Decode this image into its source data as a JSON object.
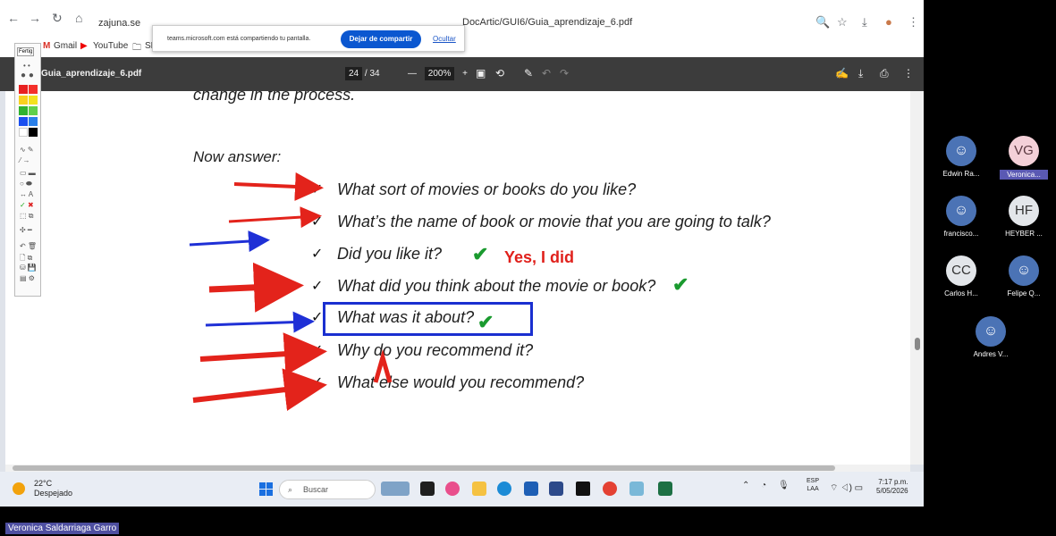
{
  "browser": {
    "url_host": "zajuna.se",
    "url_path": "DocArtic/GUI6/Guia_aprendizaje_6.pdf",
    "bookmarks": [
      "Gmail",
      "YouTube",
      "SE"
    ]
  },
  "share_banner": {
    "text": "teams.microsoft.com está compartiendo tu pantalla.",
    "stop_label": "Dejar de compartir",
    "hide_label": "Ocultar"
  },
  "pdf": {
    "file_name": "Guia_aprendizaje_6.pdf",
    "page_current": "24",
    "page_total": "/ 34",
    "zoom": "200%",
    "zoom_minus": "—",
    "zoom_plus": "+"
  },
  "document": {
    "top_line": "change in the process.",
    "heading": "Now answer:",
    "questions": [
      "What sort of movies or books do you like?",
      "What’s the name of book or movie that you are going to talk?",
      "Did you like it?",
      "What did you think about the movie or book?",
      "What was it about?",
      "Why do you recommend it?",
      "What else would you recommend?"
    ],
    "answer_note": "Yes, I did",
    "tick": "✓"
  },
  "annotation_toolbar": {
    "label": "Fertig",
    "colors": [
      "#e82020",
      "#f4302a",
      "#f7d11e",
      "#f2e21d",
      "#2fb22f",
      "#5fd04a",
      "#1a4ff0",
      "#2a7fe8",
      "#ffffff",
      "#000000"
    ]
  },
  "taskbar": {
    "temperature": "22°C",
    "condition": "Despejado",
    "search_placeholder": "Buscar",
    "lang_line1": "ESP",
    "lang_line2": "LAA",
    "time": "7:17 p.m.",
    "date": "5/05/2026"
  },
  "participants": [
    {
      "initials": "",
      "name": "Edwin Ra...",
      "style": "blue",
      "highlight": false
    },
    {
      "initials": "VG",
      "name": "Veronica...",
      "style": "pink",
      "highlight": true
    },
    {
      "initials": "",
      "name": "francisco...",
      "style": "blue",
      "highlight": false
    },
    {
      "initials": "HF",
      "name": "HEYBER ...",
      "style": "light",
      "highlight": false
    },
    {
      "initials": "CC",
      "name": "Carlos H...",
      "style": "light",
      "highlight": false
    },
    {
      "initials": "",
      "name": "Felipe Q...",
      "style": "blue",
      "highlight": false
    },
    {
      "initials": "",
      "name": "Andres V...",
      "style": "blue",
      "highlight": false
    }
  ],
  "self_name": "Veronica Saldarriaga Garro"
}
